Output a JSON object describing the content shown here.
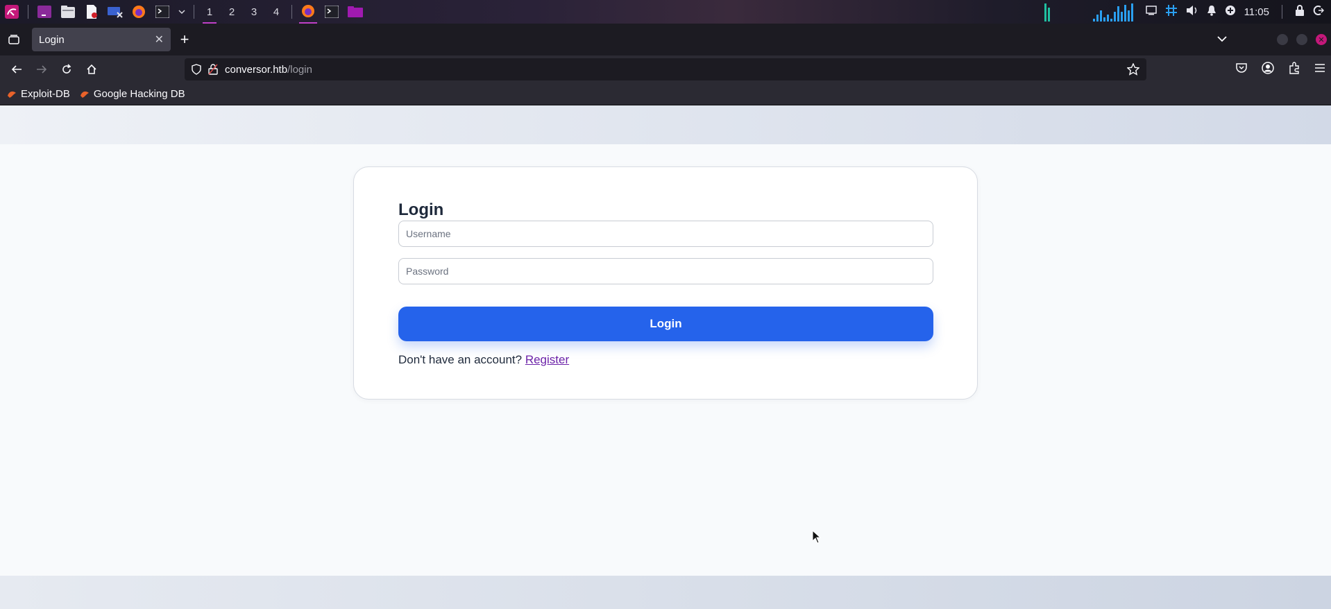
{
  "os_panel": {
    "workspaces": [
      "1",
      "2",
      "3",
      "4"
    ],
    "clock": "11:05",
    "icons": [
      "kali-menu-icon",
      "terminal-purple-icon",
      "file-manager-icon",
      "text-editor-icon",
      "screenshot-icon",
      "firefox-icon",
      "terminal-icon",
      "chevron-down-icon"
    ]
  },
  "browser": {
    "tab": {
      "title": "Login"
    },
    "url": {
      "host": "conversor.htb",
      "path": "/login"
    },
    "bookmarks": [
      {
        "label": "Exploit-DB"
      },
      {
        "label": "Google Hacking DB"
      }
    ]
  },
  "page": {
    "title": "Login",
    "username": {
      "placeholder": "Username",
      "value": ""
    },
    "password": {
      "placeholder": "Password",
      "value": ""
    },
    "login_button": "Login",
    "no_account_text": "Don't have an account?",
    "register_link": "Register"
  },
  "colors": {
    "primary_button": "#2563eb",
    "link": "#6b21a8",
    "page_bg": "#f8fafc"
  }
}
